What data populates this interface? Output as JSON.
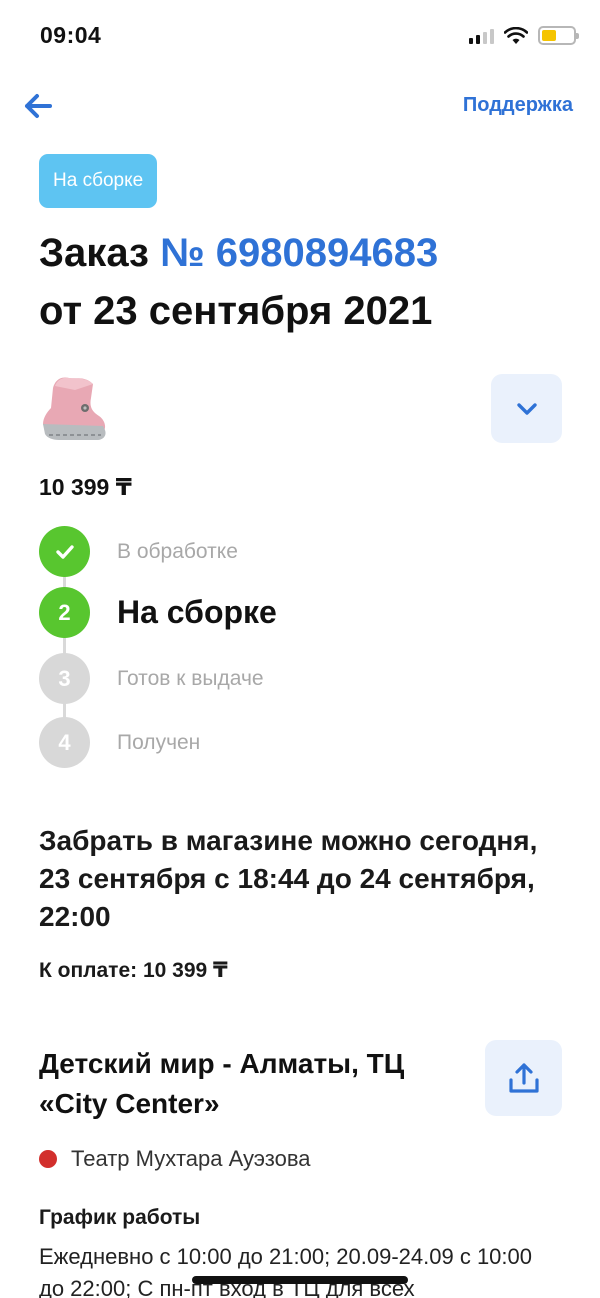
{
  "status_bar": {
    "time": "09:04",
    "signal_icon": "signal-icon",
    "wifi_icon": "wifi-icon",
    "battery_icon": "battery-icon",
    "battery_level": 0.45
  },
  "nav": {
    "back_icon": "arrow-left-icon",
    "support_label": "Поддержка"
  },
  "order": {
    "status_chip": "На сборке",
    "title_prefix": "Заказ ",
    "number": "№ 6980894683",
    "date": "от 23 сентября 2021",
    "product_image": "pink-boot-image",
    "expand_icon": "chevron-down-icon",
    "price": "10 399 ₸"
  },
  "steps": [
    {
      "marker": "check-icon",
      "label": "В обработке",
      "state": "done"
    },
    {
      "marker": "2",
      "label": "На сборке",
      "state": "active"
    },
    {
      "marker": "3",
      "label": "Готов к выдаче",
      "state": "todo"
    },
    {
      "marker": "4",
      "label": "Получен",
      "state": "todo"
    }
  ],
  "pickup": {
    "text": "Забрать в магазине можно сегодня, 23 сентября с 18:44 до 24 сентября, 22:00",
    "payment": "К оплате: 10 399 ₸"
  },
  "store": {
    "name": "Детский мир - Алматы, ТЦ «City Center»",
    "share_icon": "share-icon",
    "metro": "Театр Мухтара Ауэзова",
    "metro_color": "#d22f2c",
    "schedule_title": "График работы",
    "schedule_text": "Ежедневно с 10:00 до 21:00; 20.09-24.09 с 10:00 до 22:00; С пн-пт вход в ТЦ для всех"
  },
  "colors": {
    "accent": "#2f72d6",
    "chip": "#5ec4f2",
    "step_done": "#58c62f",
    "step_todo": "#d8d8d8"
  }
}
